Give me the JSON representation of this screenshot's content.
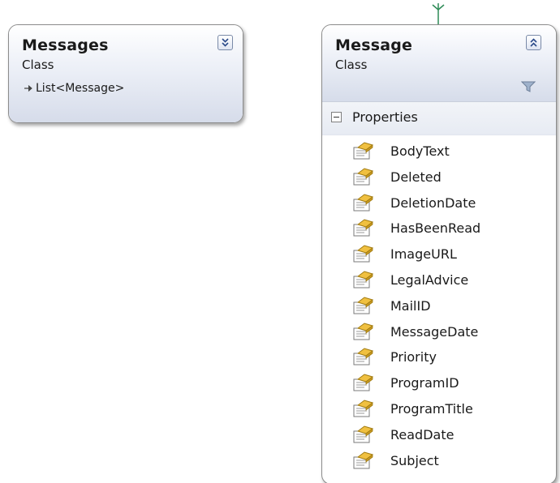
{
  "messages_class": {
    "name": "Messages",
    "kind": "Class",
    "association": "List<Message>",
    "toggle_icon": "expand-chevrons-icon"
  },
  "message_class": {
    "name": "Message",
    "kind": "Class",
    "toggle_icon": "collapse-chevrons-icon",
    "compartment": {
      "label": "Properties",
      "properties": [
        "BodyText",
        "Deleted",
        "DeletionDate",
        "HasBeenRead",
        "ImageURL",
        "LegalAdvice",
        "MailID",
        "MessageDate",
        "Priority",
        "ProgramID",
        "ProgramTitle",
        "ReadDate",
        "Subject"
      ]
    }
  },
  "colors": {
    "connector": "#2e8b57",
    "header_gradient_bottom": "#d6dcea",
    "property_icon_gold": "#f0c040"
  }
}
